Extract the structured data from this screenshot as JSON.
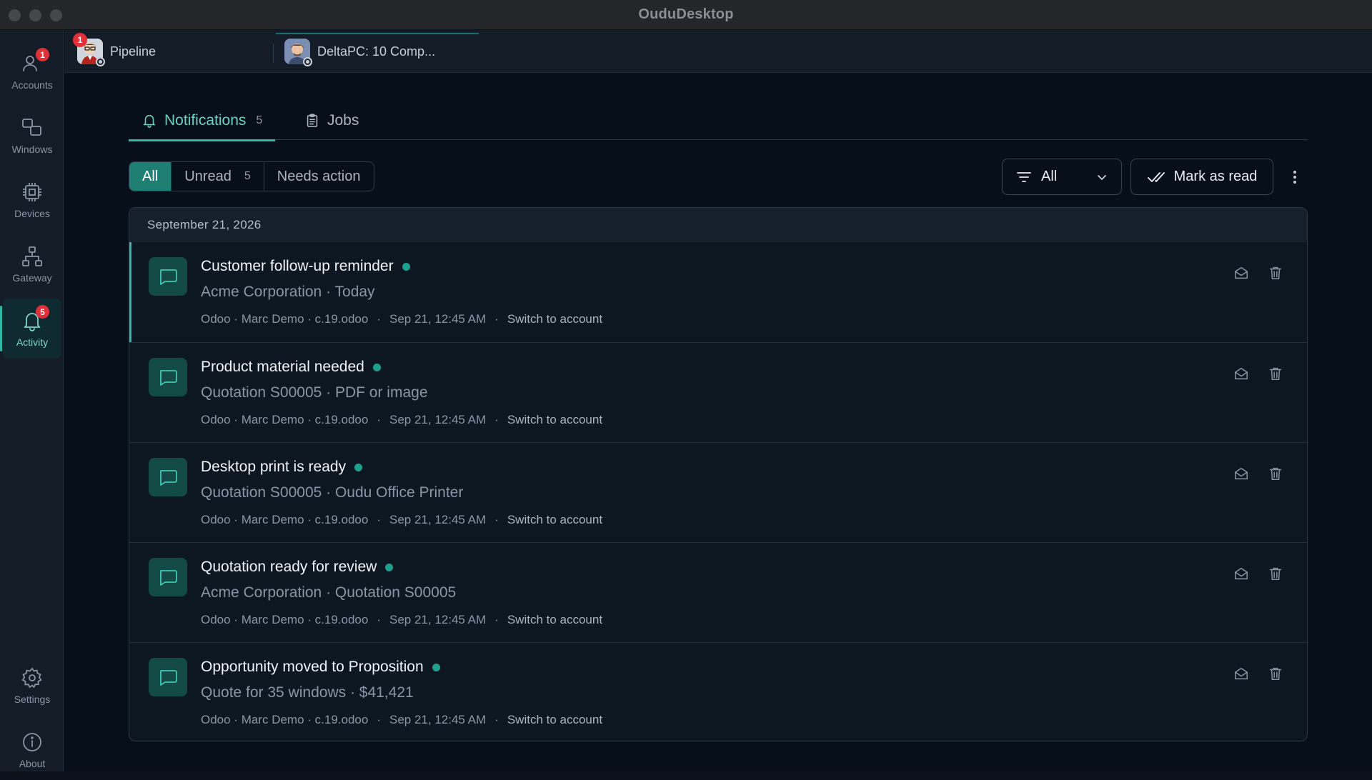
{
  "window": {
    "title": "OuduDesktop"
  },
  "rail": {
    "items": [
      {
        "label": "Accounts",
        "icon": "users-icon",
        "badge": "1"
      },
      {
        "label": "Windows",
        "icon": "windows-icon",
        "badge": ""
      },
      {
        "label": "Devices",
        "icon": "chip-icon",
        "badge": ""
      },
      {
        "label": "Gateway",
        "icon": "network-icon",
        "badge": ""
      },
      {
        "label": "Activity",
        "icon": "bell-icon",
        "badge": "5"
      },
      {
        "label": "Settings",
        "icon": "gear-icon",
        "badge": ""
      },
      {
        "label": "About",
        "icon": "info-icon",
        "badge": ""
      }
    ]
  },
  "window_tabs": [
    {
      "label": "Pipeline",
      "badge": "1"
    },
    {
      "label": "DeltaPC: 10 Comp..."
    }
  ],
  "subtabs": {
    "notifications": {
      "label": "Notifications",
      "count": "5"
    },
    "jobs": {
      "label": "Jobs"
    }
  },
  "segments": {
    "all": "All",
    "unread": "Unread",
    "unread_count": "5",
    "needs_action": "Needs action"
  },
  "filter": {
    "selected": "All"
  },
  "mark_read": {
    "label": "Mark as read"
  },
  "date_header": "September 21, 2026",
  "notifications": [
    {
      "title": "Customer follow-up reminder",
      "subtitle": "Acme Corporation · Today",
      "source": "Odoo · Marc Demo · c.19.odoo",
      "time": "Sep 21, 12:45 AM",
      "action": "Switch to account"
    },
    {
      "title": "Product material needed",
      "subtitle": "Quotation S00005 · PDF or image",
      "source": "Odoo · Marc Demo · c.19.odoo",
      "time": "Sep 21, 12:45 AM",
      "action": "Switch to account"
    },
    {
      "title": "Desktop print is ready",
      "subtitle": "Quotation S00005 · Oudu Office Printer",
      "source": "Odoo · Marc Demo · c.19.odoo",
      "time": "Sep 21, 12:45 AM",
      "action": "Switch to account"
    },
    {
      "title": "Quotation ready for review",
      "subtitle": "Acme Corporation · Quotation S00005",
      "source": "Odoo · Marc Demo · c.19.odoo",
      "time": "Sep 21, 12:45 AM",
      "action": "Switch to account"
    },
    {
      "title": "Opportunity moved to Proposition",
      "subtitle": "Quote for 35 windows · $41,421",
      "source": "Odoo · Marc Demo · c.19.odoo",
      "time": "Sep 21, 12:45 AM",
      "action": "Switch to account"
    }
  ],
  "colors": {
    "accent": "#2fb9a3",
    "badge": "#e0303a",
    "unread_dot": "#1fa08f"
  }
}
